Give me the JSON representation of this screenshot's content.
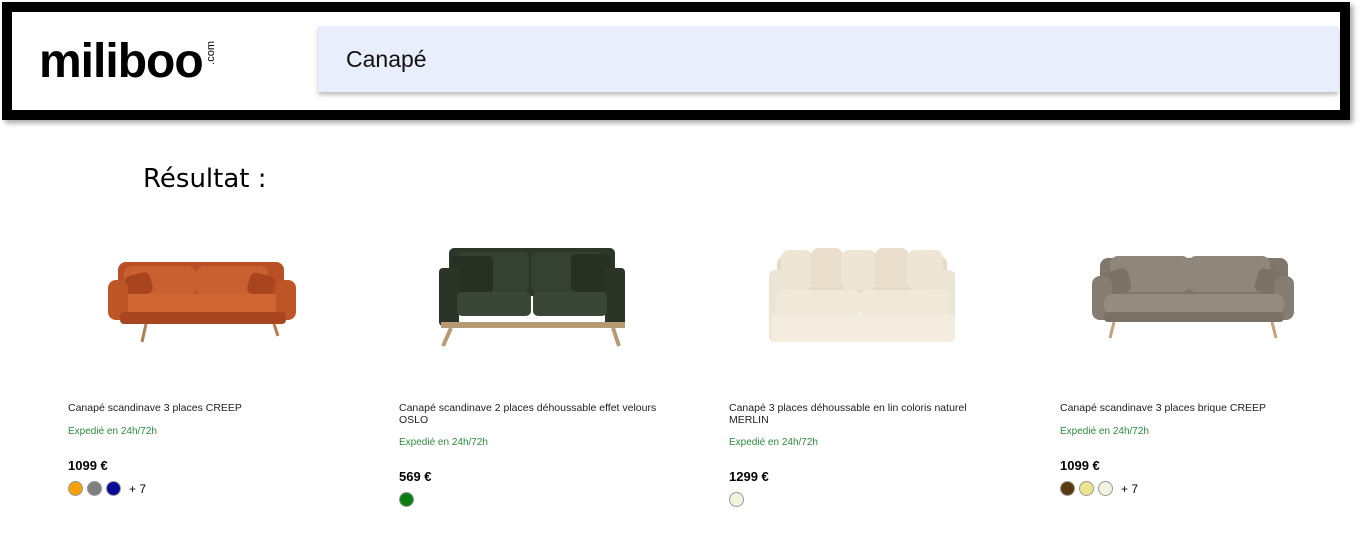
{
  "header": {
    "logo_text": "miliboo",
    "logo_suffix": ".com",
    "search_value": "Canapé"
  },
  "results_label": "Résultat :",
  "products": [
    {
      "name": "Canapé scandinave 3 places CREEP",
      "shipping": "Expedié en 24h/72h",
      "price": "1099 €",
      "colors": [
        "#f5a10c",
        "#808080",
        "#0a0a96"
      ],
      "more_colors": "+ 7",
      "sofa_color": "#c4592c"
    },
    {
      "name": "Canapé scandinave 2 places déhoussable effet velours OSLO",
      "shipping": "Expedié en 24h/72h",
      "price": "569 €",
      "colors": [
        "#0b7d12"
      ],
      "more_colors": "",
      "sofa_color": "#2f3a2c"
    },
    {
      "name": "Canapé 3 places déhoussable en lin coloris naturel MERLIN",
      "shipping": "Expedié en 24h/72h",
      "price": "1299 €",
      "colors": [
        "#f3f2dd"
      ],
      "more_colors": "",
      "sofa_color": "#ece3d2"
    },
    {
      "name": "Canapé scandinave 3 places brique CREEP",
      "shipping": "Expedié en 24h/72h",
      "price": "1099 €",
      "colors": [
        "#5a3a12",
        "#ece48e",
        "#f4f3e2"
      ],
      "more_colors": "+ 7",
      "sofa_color": "#8d8477"
    }
  ]
}
